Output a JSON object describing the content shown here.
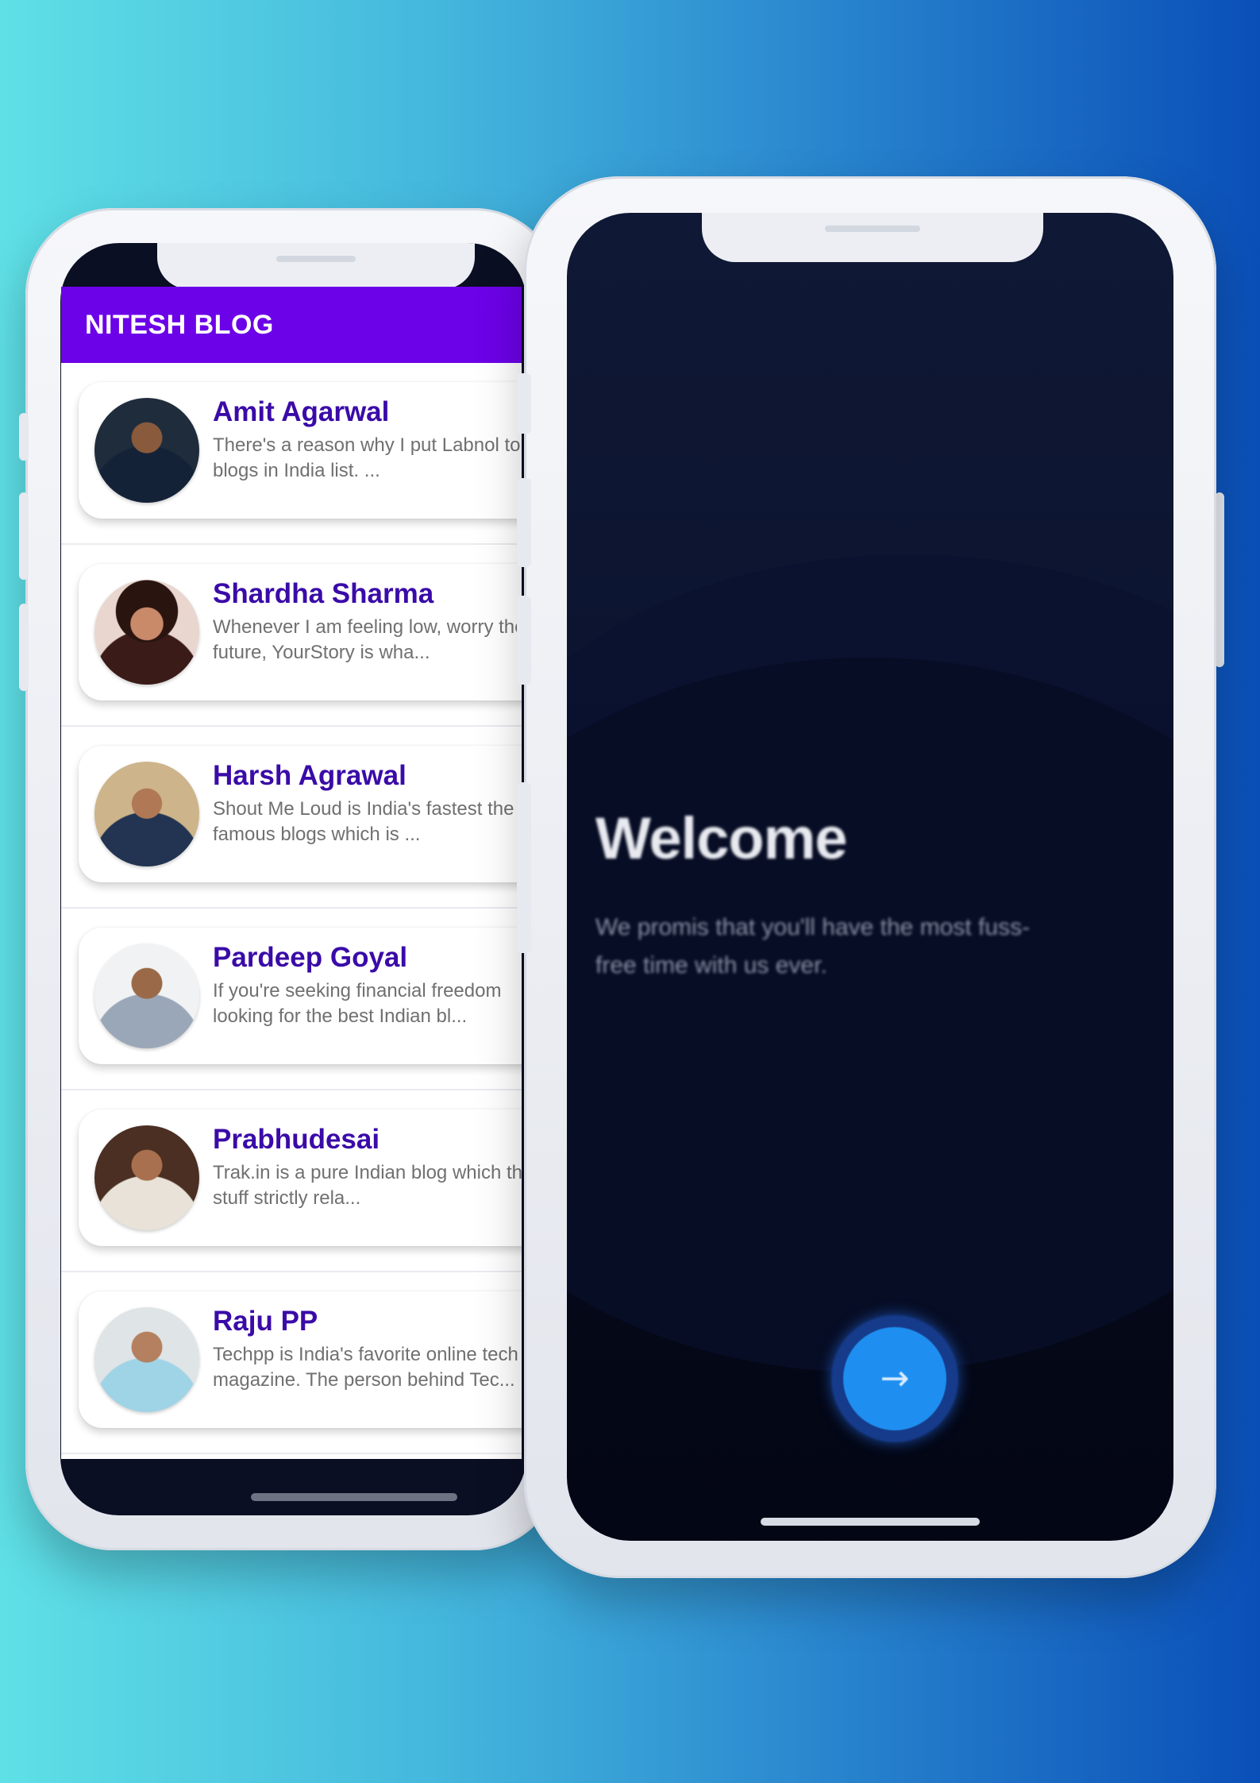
{
  "blog_app": {
    "app_bar": {
      "title": "NITESH BLOG"
    },
    "authors": [
      {
        "name": "Amit Agarwal",
        "excerpt": "There's a reason why I put Labnol top blogs in India list. ..."
      },
      {
        "name": "Shardha Sharma",
        "excerpt": "Whenever I am feeling low, worry the future, YourStory is wha..."
      },
      {
        "name": "Harsh Agrawal",
        "excerpt": "Shout Me Loud is India's fastest the famous blogs which is ..."
      },
      {
        "name": "Pardeep Goyal",
        "excerpt": "If you're seeking financial freedom looking for the best Indian bl..."
      },
      {
        "name": "Prabhudesai",
        "excerpt": "Trak.in is a pure Indian blog which the stuff strictly rela..."
      },
      {
        "name": "Raju PP",
        "excerpt": "Techpp is India's favorite online tech magazine. The person behind Tec..."
      }
    ]
  },
  "welcome_screen": {
    "title": "Welcome",
    "subtitle": "We promis that you'll have the most fuss-free time with us ever.",
    "next_icon": "arrow-right-icon"
  },
  "colors": {
    "app_bar": "#6c02e8",
    "author_name": "#3a0ba8",
    "next_button": "#1e8ff0",
    "welcome_bg": "#060a1c"
  }
}
